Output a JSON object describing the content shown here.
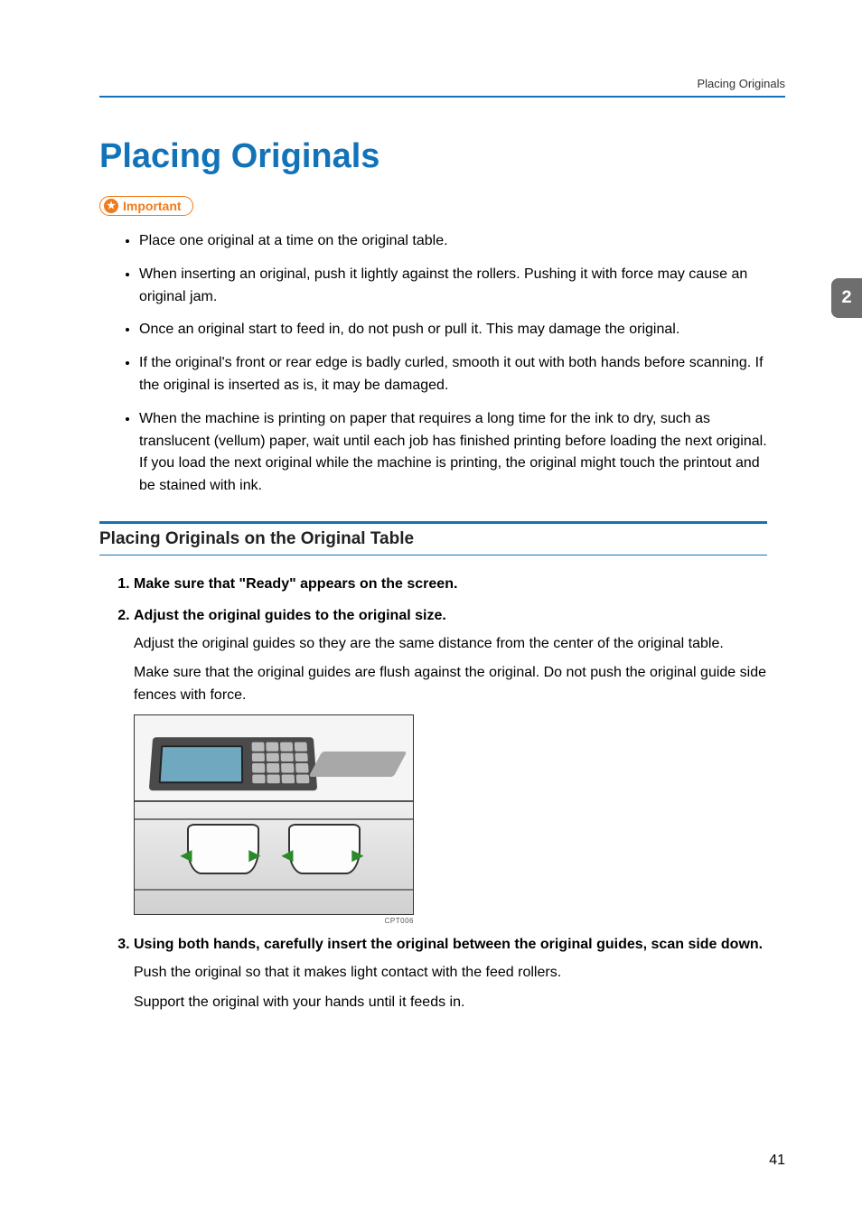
{
  "header": {
    "running_head": "Placing Originals"
  },
  "chapter_tab": "2",
  "title": "Placing Originals",
  "important": {
    "label": "Important",
    "items": [
      "Place one original at a time on the original table.",
      "When inserting an original, push it lightly against the rollers. Pushing it with force may cause an original jam.",
      "Once an original start to feed in, do not push or pull it. This may damage the original.",
      "If the original's front or rear edge is badly curled, smooth it out with both hands before scanning. If the original is inserted as is, it may be damaged.",
      "When the machine is printing on paper that requires a long time for the ink to dry, such as translucent (vellum) paper, wait until each job has finished printing before loading the next original. If you load the next original while the machine is printing, the original might touch the printout and be stained with ink."
    ]
  },
  "section": {
    "heading": "Placing Originals on the Original Table",
    "steps": [
      {
        "head": "Make sure that \"Ready\" appears on the screen."
      },
      {
        "head": "Adjust the original guides to the original size.",
        "body": [
          "Adjust the original guides so they are the same distance from the center of the original table.",
          "Make sure that the original guides are flush against the original. Do not push the original guide side fences with force."
        ],
        "figure_caption": "CPT006"
      },
      {
        "head": "Using both hands, carefully insert the original between the original guides, scan side down.",
        "body": [
          "Push the original so that it makes light contact with the feed rollers.",
          "Support the original with your hands until it feeds in."
        ]
      }
    ]
  },
  "page_number": "41"
}
